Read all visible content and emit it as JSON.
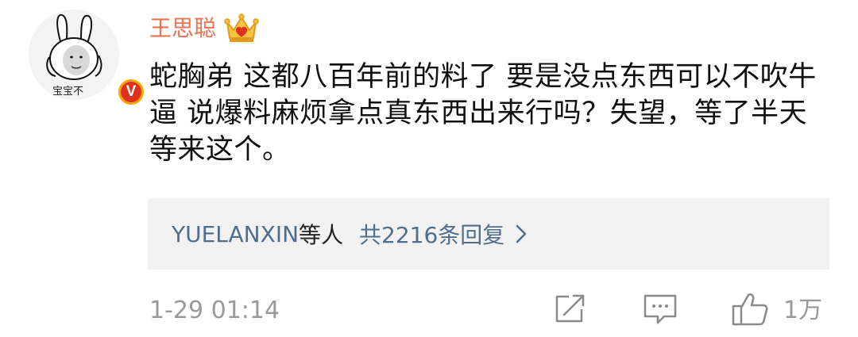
{
  "user": {
    "name": "王思聪",
    "avatar_caption": "宝宝不",
    "verified_badge": "V",
    "badge_icon": "crown-icon"
  },
  "comment": {
    "text": "蛇胸弟 这都八百年前的料了 要是没点东西可以不吹牛逼 说爆料麻烦拿点真东西出来行吗？失望，等了半天等来这个。"
  },
  "replies": {
    "users": "YUELANXIN",
    "users_suffix": "等人",
    "count_label": "共2216条回复"
  },
  "footer": {
    "timestamp": "1-29 01:14",
    "share_icon": "share-icon",
    "comment_icon": "comment-icon",
    "like_icon": "thumbs-up-icon",
    "like_count": "1万"
  },
  "colors": {
    "username": "#eb7350",
    "link": "#4f6d8c",
    "muted": "#9a9a9a",
    "reply_bg": "#f2f2f2",
    "badge_red": "#e0301e",
    "badge_ring": "#f7a600"
  }
}
